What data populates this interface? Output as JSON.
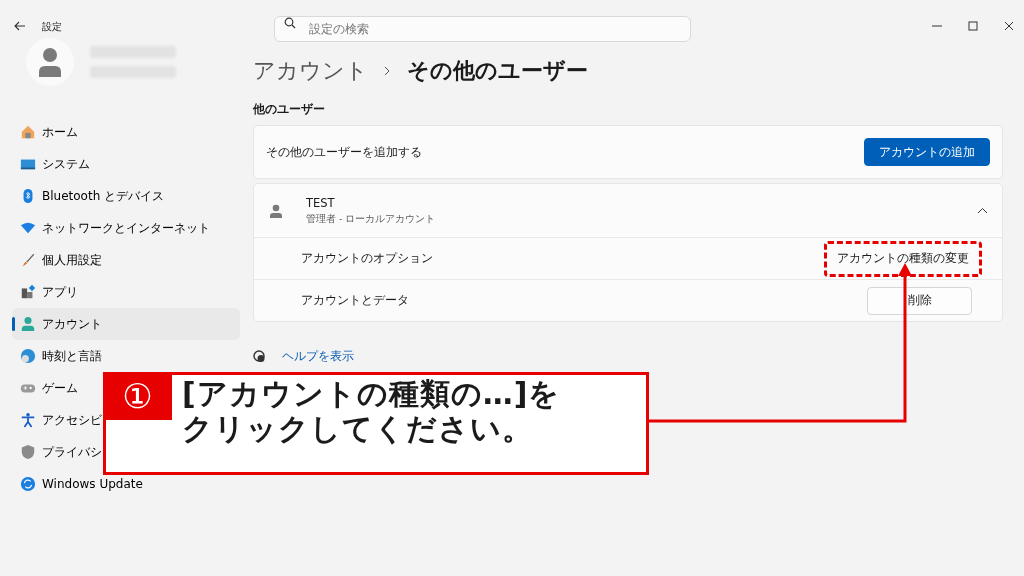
{
  "window": {
    "title": "設定"
  },
  "search": {
    "placeholder": "設定の検索"
  },
  "sidebar": {
    "items": [
      {
        "label": "ホーム",
        "selected": false
      },
      {
        "label": "システム",
        "selected": false
      },
      {
        "label": "Bluetooth とデバイス",
        "selected": false
      },
      {
        "label": "ネットワークとインターネット",
        "selected": false
      },
      {
        "label": "個人用設定",
        "selected": false
      },
      {
        "label": "アプリ",
        "selected": false
      },
      {
        "label": "アカウント",
        "selected": true
      },
      {
        "label": "時刻と言語",
        "selected": false
      },
      {
        "label": "ゲーム",
        "selected": false
      },
      {
        "label": "アクセシビ",
        "selected": false
      },
      {
        "label": "プライバシ",
        "selected": false
      },
      {
        "label": "Windows Update",
        "selected": false
      }
    ]
  },
  "breadcrumb": [
    "アカウント",
    "その他のユーザー"
  ],
  "section_title": "他のユーザー",
  "add_user": {
    "label": "その他のユーザーを追加する",
    "button": "アカウントの追加"
  },
  "user": {
    "name": "TEST",
    "subtitle": "管理者 - ローカルアカウント",
    "expanded": true,
    "rows": [
      {
        "label": "アカウントのオプション",
        "button": "アカウントの種類の変更",
        "highlighted": true
      },
      {
        "label": "アカウントとデータ",
        "button": "削除",
        "highlighted": false
      }
    ]
  },
  "help_link": "ヘルプを表示",
  "callout": {
    "number": "①",
    "lines": [
      "[アカウントの種類の…]を",
      "クリックしてください。"
    ]
  }
}
